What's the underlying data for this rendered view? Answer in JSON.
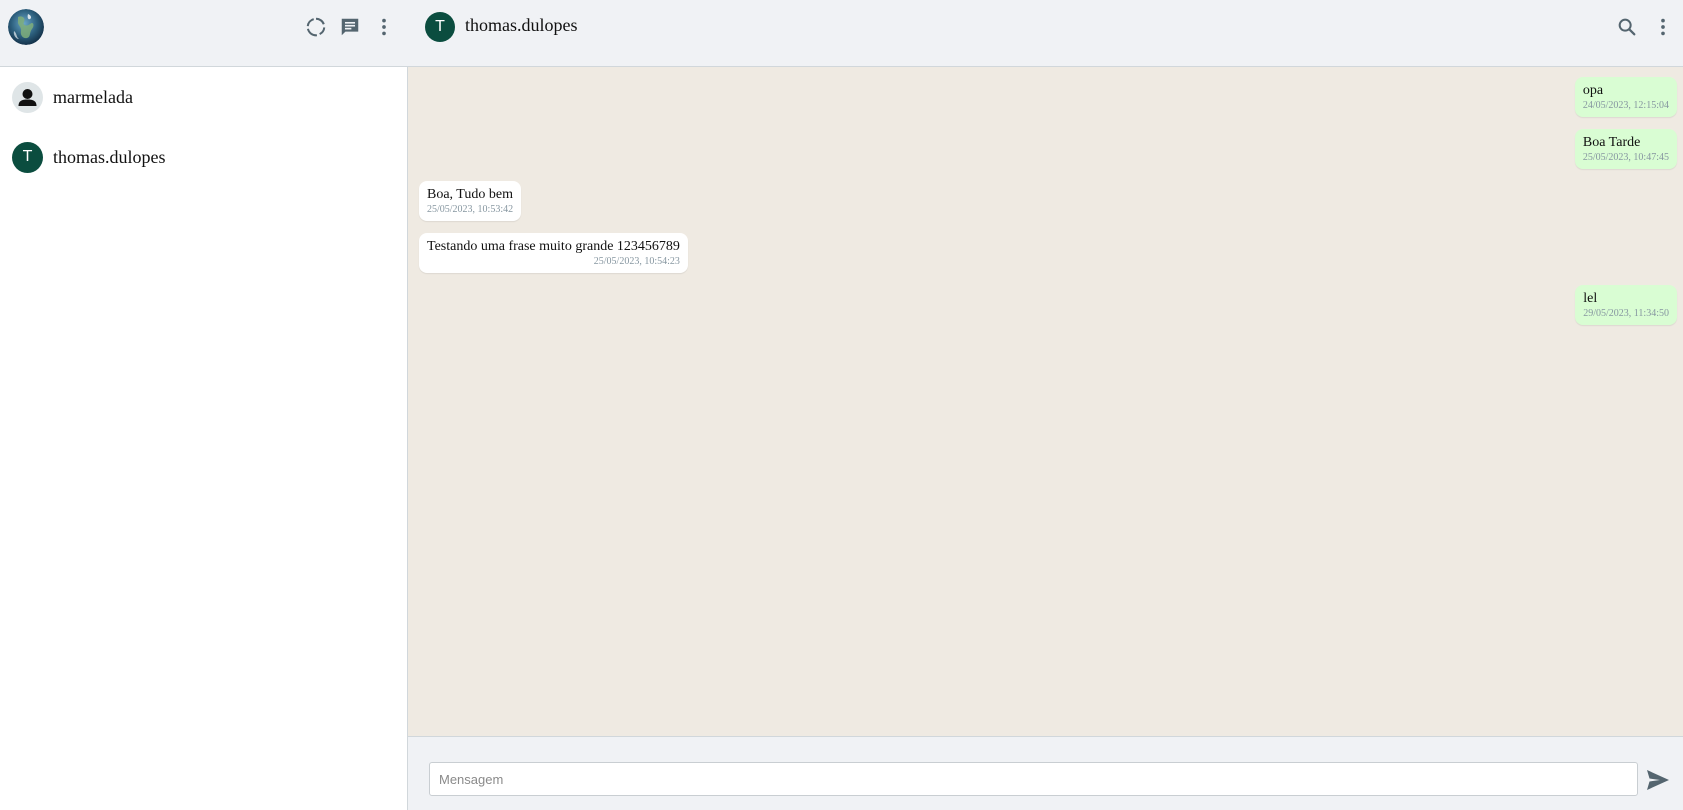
{
  "sidebar": {
    "header": {
      "profile_avatar_icon": "globe-avatar",
      "icons": [
        "status-icon",
        "new-chat-icon",
        "menu-dots-icon"
      ]
    },
    "contacts": [
      {
        "name": "marmelada",
        "avatar_type": "default-person-icon"
      },
      {
        "name": "thomas.dulopes",
        "avatar_letter": "T"
      }
    ]
  },
  "chat": {
    "header": {
      "avatar_letter": "T",
      "title": "thomas.dulopes",
      "icons": [
        "search-icon",
        "menu-dots-icon"
      ]
    },
    "messages": [
      {
        "direction": "out",
        "text": "opa",
        "time": "24/05/2023, 12:15:04"
      },
      {
        "direction": "out",
        "text": "Boa Tarde",
        "time": "25/05/2023, 10:47:45"
      },
      {
        "direction": "in",
        "text": "Boa, Tudo bem",
        "time": "25/05/2023, 10:53:42"
      },
      {
        "direction": "in",
        "text": "Testando uma frase muito grande 123456789",
        "time": "25/05/2023, 10:54:23"
      },
      {
        "direction": "out",
        "text": "lel",
        "time": "29/05/2023, 11:34:50"
      }
    ],
    "composer": {
      "placeholder": "Mensagem",
      "value": "",
      "send_icon": "send-icon"
    }
  },
  "colors": {
    "panel_bg": "#f0f2f5",
    "chat_bg": "#efeae2",
    "outgoing_bubble": "#d9fdd3",
    "incoming_bubble": "#ffffff",
    "avatar_green": "#0b4d3f",
    "icon_gray": "#54656f"
  }
}
